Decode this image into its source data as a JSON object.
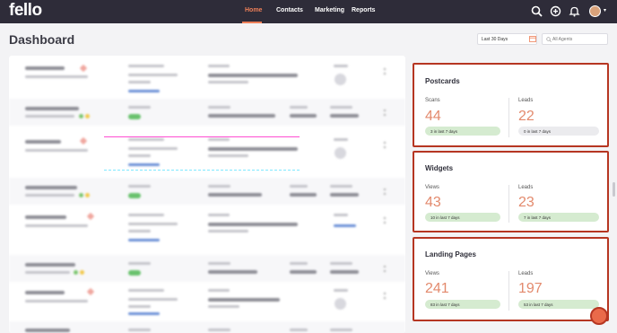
{
  "app": {
    "logo": "fello"
  },
  "nav": {
    "items": [
      {
        "label": "Home",
        "active": true
      },
      {
        "label": "Contacts",
        "active": false
      },
      {
        "label": "Marketing",
        "active": false
      },
      {
        "label": "Reports",
        "active": false
      }
    ],
    "icons": [
      "search-icon",
      "add-circle-icon",
      "bell-icon",
      "user-avatar"
    ]
  },
  "header": {
    "title": "Dashboard",
    "date_range": "Last 30 Days",
    "agents_placeholder": "All Agents"
  },
  "cards": {
    "postcards": {
      "title": "Postcards",
      "left": {
        "label": "Scans",
        "value": "44",
        "trend": "3 in last 7 days"
      },
      "right": {
        "label": "Leads",
        "value": "22",
        "trend": "0 in last 7 days"
      }
    },
    "widgets": {
      "title": "Widgets",
      "left": {
        "label": "Views",
        "value": "43",
        "trend": "10 in last 7 days"
      },
      "right": {
        "label": "Leads",
        "value": "23",
        "trend": "7 in last 7 days"
      }
    },
    "landing_pages": {
      "title": "Landing Pages",
      "left": {
        "label": "Views",
        "value": "241",
        "trend": "83 in last 7 days"
      },
      "right": {
        "label": "Leads",
        "value": "197",
        "trend": "53 in last 7 days"
      }
    }
  },
  "colors": {
    "nav_bg": "#2e2c39",
    "accent": "#ee7f58",
    "highlight_border": "#b63622",
    "metric_value": "#e38a6d",
    "pill_green": "#d5ebd0",
    "pill_grey": "#ebebee"
  }
}
